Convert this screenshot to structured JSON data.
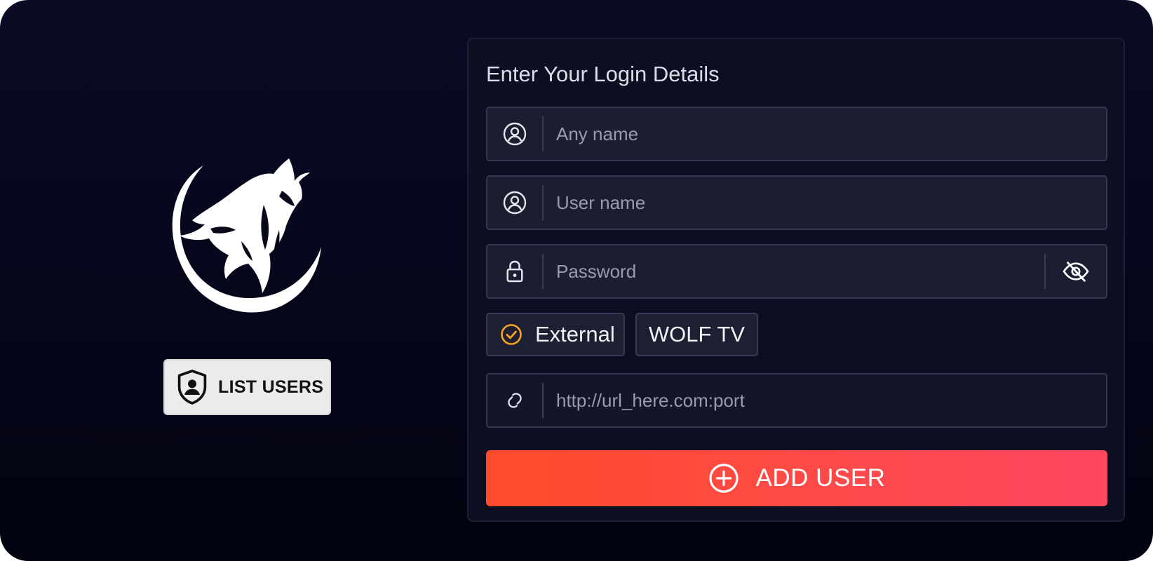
{
  "brand": {
    "logo_icon": "howling-wolf-logo"
  },
  "left": {
    "list_users_label": "LIST USERS",
    "list_users_icon": "user-shield-icon"
  },
  "form": {
    "title": "Enter Your Login Details",
    "any_name": {
      "placeholder": "Any name",
      "value": "",
      "icon": "user-circle-icon"
    },
    "user_name": {
      "placeholder": "User name",
      "value": "",
      "icon": "user-circle-icon"
    },
    "password": {
      "placeholder": "Password",
      "value": "",
      "icon": "lock-icon",
      "toggle_icon": "eye-off-icon"
    },
    "options": [
      {
        "label": "External",
        "selected": true,
        "icon": "check-circle-icon"
      },
      {
        "label": "WOLF TV",
        "selected": false
      }
    ],
    "url": {
      "placeholder": "http://url_here.com:port",
      "value": "",
      "icon": "link-icon"
    },
    "add_user_label": "ADD USER",
    "add_user_icon": "plus-circle-icon"
  },
  "colors": {
    "accent_check": "#f5a623",
    "button_gradient_start": "#ff4b2b",
    "button_gradient_end": "#ff4861",
    "background": "#05061a"
  }
}
